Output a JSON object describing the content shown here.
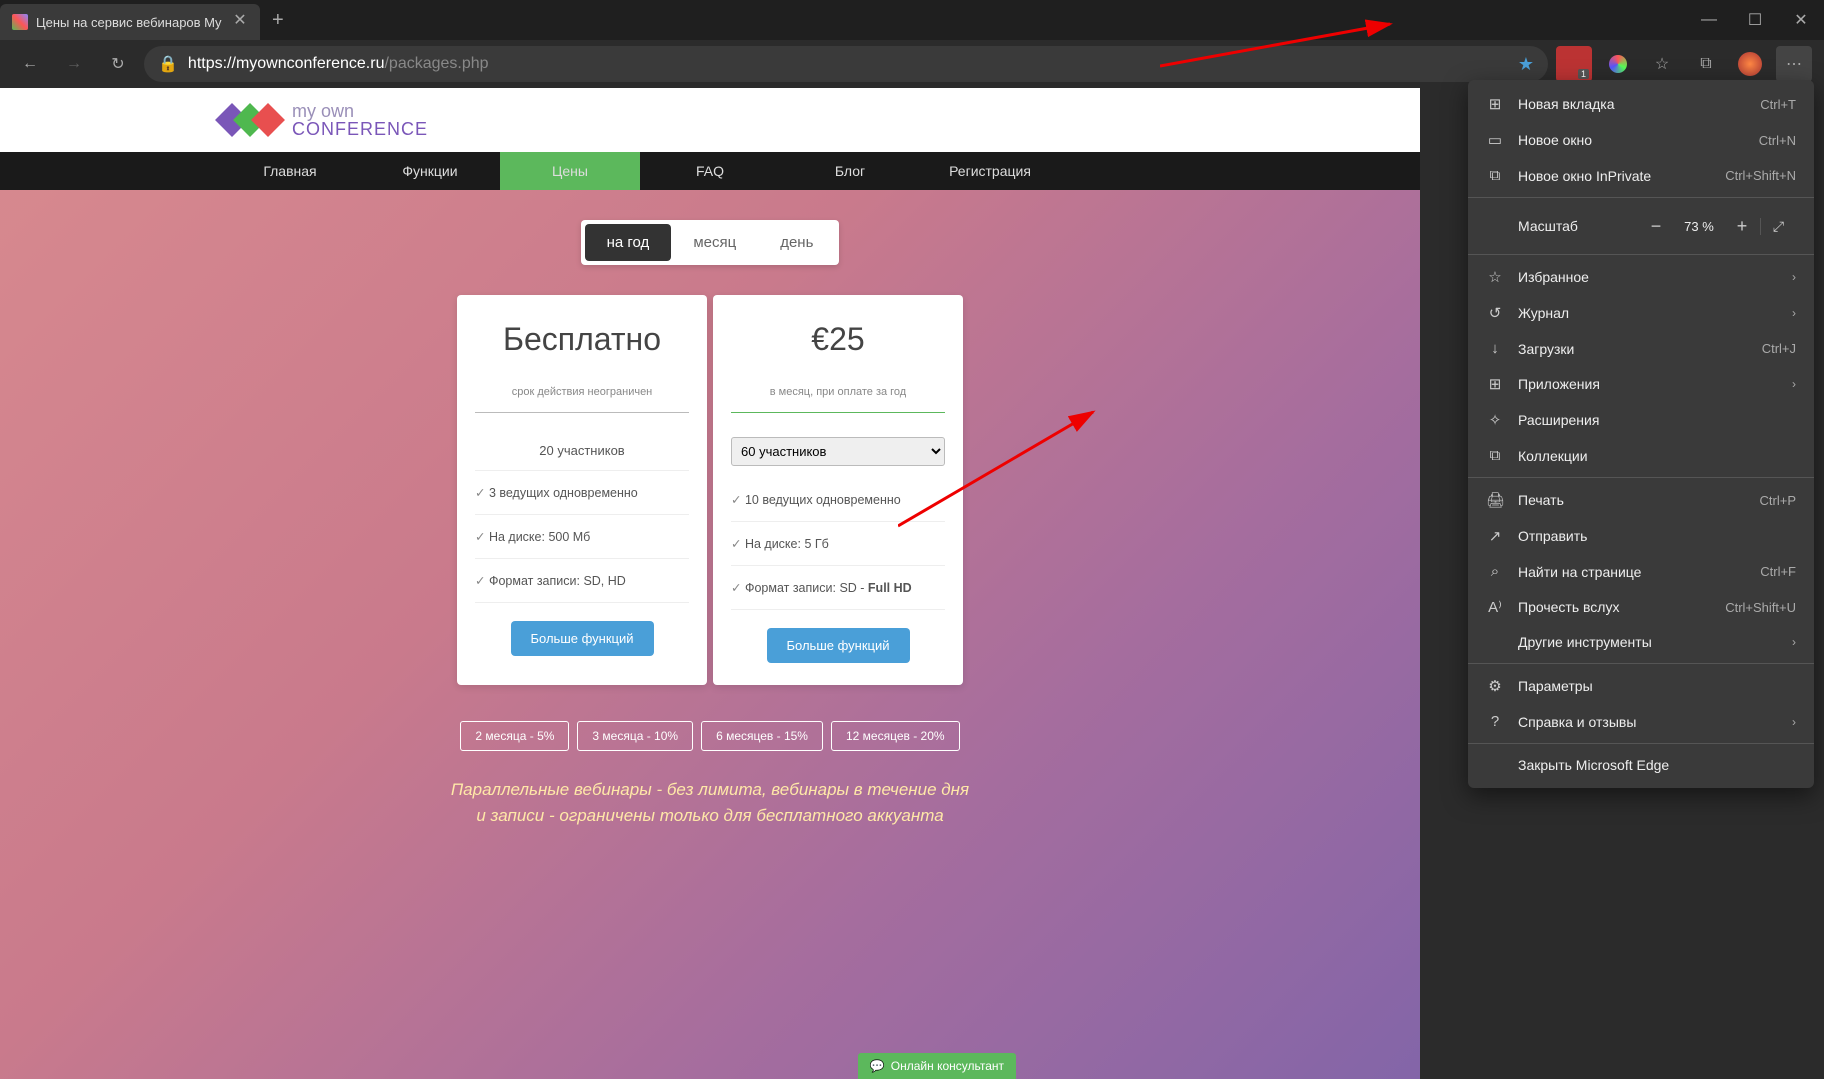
{
  "browser": {
    "tab_title": "Цены на сервис вебинаров My",
    "url_host": "https://myownconference.ru",
    "url_path": "/packages.php",
    "ext_badge": "1",
    "win": {
      "min": "—",
      "max": "☐",
      "close": "✕"
    },
    "menu_btn": "⋯"
  },
  "edge_menu": {
    "items": [
      {
        "icon": "⊞",
        "label": "Новая вкладка",
        "shortcut": "Ctrl+T"
      },
      {
        "icon": "▭",
        "label": "Новое окно",
        "shortcut": "Ctrl+N"
      },
      {
        "icon": "⧉",
        "label": "Новое окно InPrivate",
        "shortcut": "Ctrl+Shift+N"
      }
    ],
    "zoom": {
      "label": "Масштаб",
      "value": "73 %",
      "minus": "−",
      "plus": "+",
      "full": "⤢"
    },
    "items2": [
      {
        "icon": "☆",
        "label": "Избранное",
        "chevron": true
      },
      {
        "icon": "↺",
        "label": "Журнал",
        "chevron": true
      },
      {
        "icon": "↓",
        "label": "Загрузки",
        "shortcut": "Ctrl+J"
      },
      {
        "icon": "⊞",
        "label": "Приложения",
        "chevron": true
      },
      {
        "icon": "✧",
        "label": "Расширения"
      },
      {
        "icon": "⧉",
        "label": "Коллекции"
      }
    ],
    "items3": [
      {
        "icon": "🖨",
        "label": "Печать",
        "shortcut": "Ctrl+P"
      },
      {
        "icon": "↗",
        "label": "Отправить"
      },
      {
        "icon": "⌕",
        "label": "Найти на странице",
        "shortcut": "Ctrl+F"
      },
      {
        "icon": "A⁾",
        "label": "Прочесть вслух",
        "shortcut": "Ctrl+Shift+U"
      },
      {
        "icon": "",
        "label": "Другие инструменты",
        "chevron": true
      }
    ],
    "items4": [
      {
        "icon": "⚙",
        "label": "Параметры"
      },
      {
        "icon": "?",
        "label": "Справка и отзывы",
        "chevron": true
      }
    ],
    "items5": [
      {
        "icon": "",
        "label": "Закрыть Microsoft Edge"
      }
    ]
  },
  "site": {
    "logo": {
      "line1": "my own",
      "line2": "CONFERENCE"
    },
    "nav": [
      "Главная",
      "Функции",
      "Цены",
      "FAQ",
      "Блог",
      "Регистрация"
    ],
    "nav_active": 2,
    "periods": [
      "на год",
      "месяц",
      "день"
    ],
    "period_active": 0,
    "cards": {
      "free": {
        "title": "Бесплатно",
        "sub": "срок действия неограничен",
        "participants": "20 участников",
        "feat1": "3 ведущих одновременно",
        "feat2": "На диске: 500 Мб",
        "feat3": "Формат записи: SD, HD",
        "btn": "Больше функций"
      },
      "paid": {
        "title": "€25",
        "sub": "в месяц, при оплате за год",
        "select": "60 участников",
        "feat1": "10 ведущих одновременно",
        "feat2": "На диске: 5 Гб",
        "feat3_pre": "Формат записи: SD - ",
        "feat3_bold": "Full HD",
        "btn": "Больше функций"
      }
    },
    "discounts": [
      "2 месяца - 5%",
      "3 месяца - 10%",
      "6 месяцев - 15%",
      "12 месяцев - 20%"
    ],
    "bottom1": "Параллельные вебинары - без лимита, вебинары в течение дня",
    "bottom2": "и записи - ограничены только для бесплатного аккуанта",
    "chat": "Онлайн консультант"
  }
}
